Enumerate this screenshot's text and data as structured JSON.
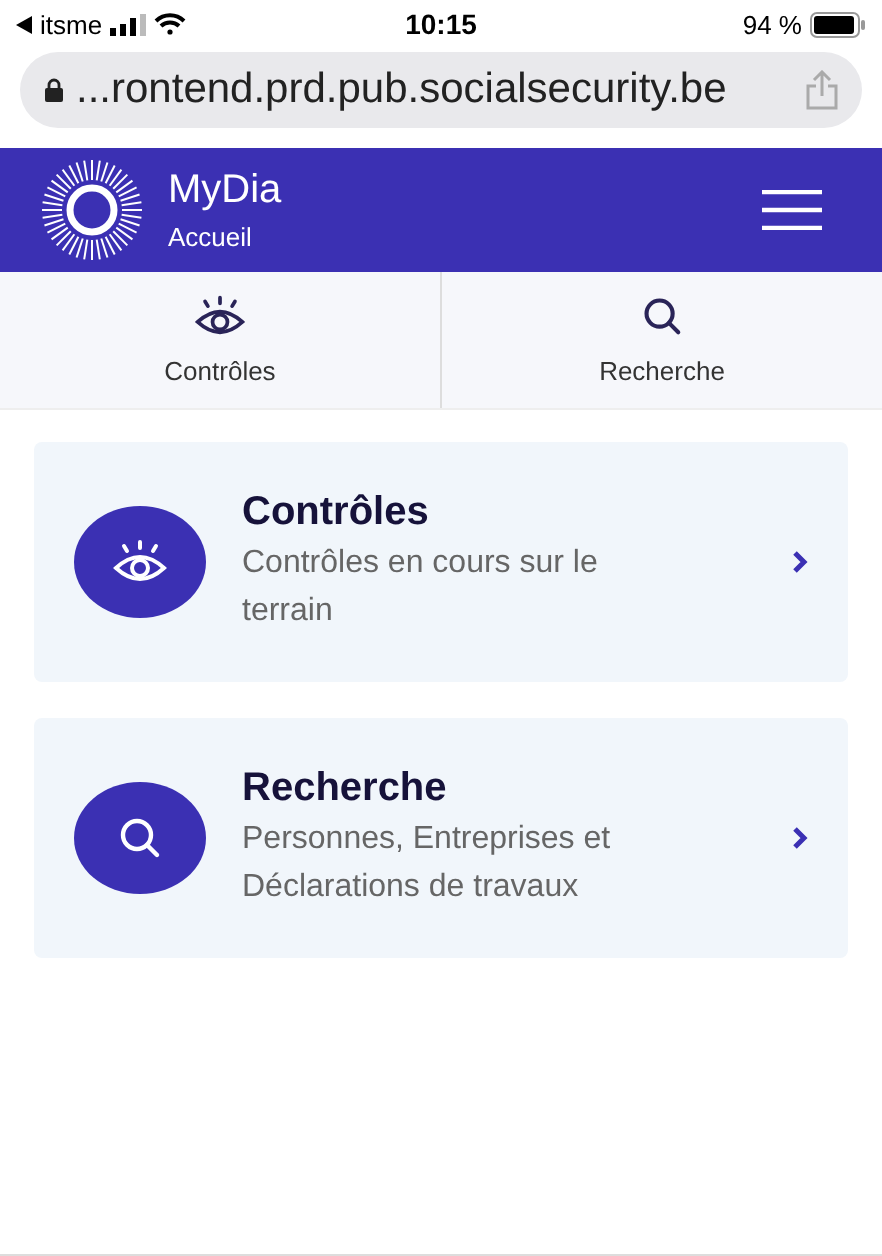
{
  "status_bar": {
    "carrier": "itsme",
    "time": "10:15",
    "battery": "94 %"
  },
  "url_bar": {
    "url": "...rontend.prd.pub.socialsecurity.be"
  },
  "header": {
    "title": "MyDia",
    "subtitle": "Accueil"
  },
  "tabs": [
    {
      "label": "Contrôles",
      "kind": "eye"
    },
    {
      "label": "Recherche",
      "kind": "search"
    }
  ],
  "cards": [
    {
      "title": "Contrôles",
      "description": "Contrôles en cours sur le terrain",
      "kind": "eye"
    },
    {
      "title": "Recherche",
      "description": "Personnes, Entreprises et Déclarations de travaux",
      "kind": "search"
    }
  ]
}
